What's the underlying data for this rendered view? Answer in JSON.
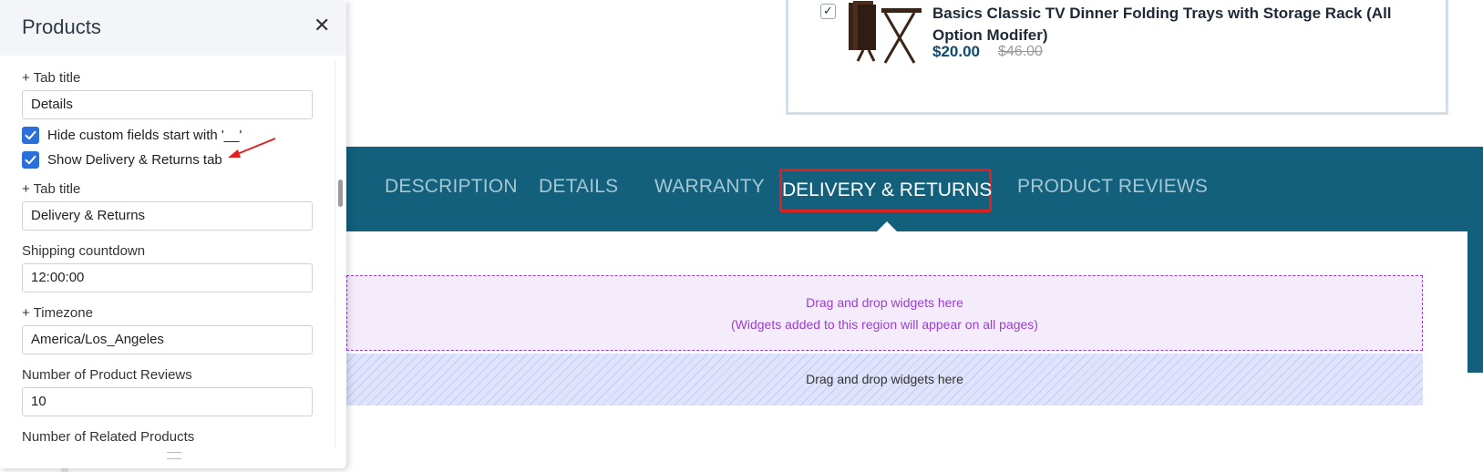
{
  "product": {
    "title": "Basics Classic TV Dinner Folding Trays with Storage Rack (All Option Modifer)",
    "price": "$20.00",
    "old_price": "$46.00",
    "checked": true
  },
  "tabs": {
    "items": [
      "DESCRIPTION",
      "DETAILS",
      "WARRANTY",
      "DELIVERY & RETURNS",
      "PRODUCT REVIEWS"
    ],
    "active_index": 3
  },
  "regions": {
    "global_line1": "Drag and drop widgets here",
    "global_line2": "(Widgets added to this region will appear on all pages)",
    "page_line": "Drag and drop widgets here"
  },
  "panel": {
    "title": "Products",
    "close_icon": "close-icon",
    "fields": {
      "tab_title_1_label": "+ Tab title",
      "tab_title_1_value": "Details",
      "hide_custom_fields_label": "Hide custom fields start with '__'",
      "hide_custom_fields_checked": true,
      "show_delivery_label": "Show Delivery & Returns tab",
      "show_delivery_checked": true,
      "tab_title_2_label": "+ Tab title",
      "tab_title_2_value": "Delivery & Returns",
      "shipping_label": "Shipping countdown",
      "shipping_value": "12:00:00",
      "timezone_label": "+ Timezone",
      "timezone_value": "America/Los_Angeles",
      "reviews_label": "Number of Product Reviews",
      "reviews_value": "10",
      "related_label": "Number of Related Products"
    }
  },
  "colors": {
    "tab_bar": "#12607c",
    "active_tab_border": "#e0201f",
    "checkbox": "#2b6fdb",
    "global_region": "#9b3fd1",
    "arrow": "#e0201f"
  }
}
